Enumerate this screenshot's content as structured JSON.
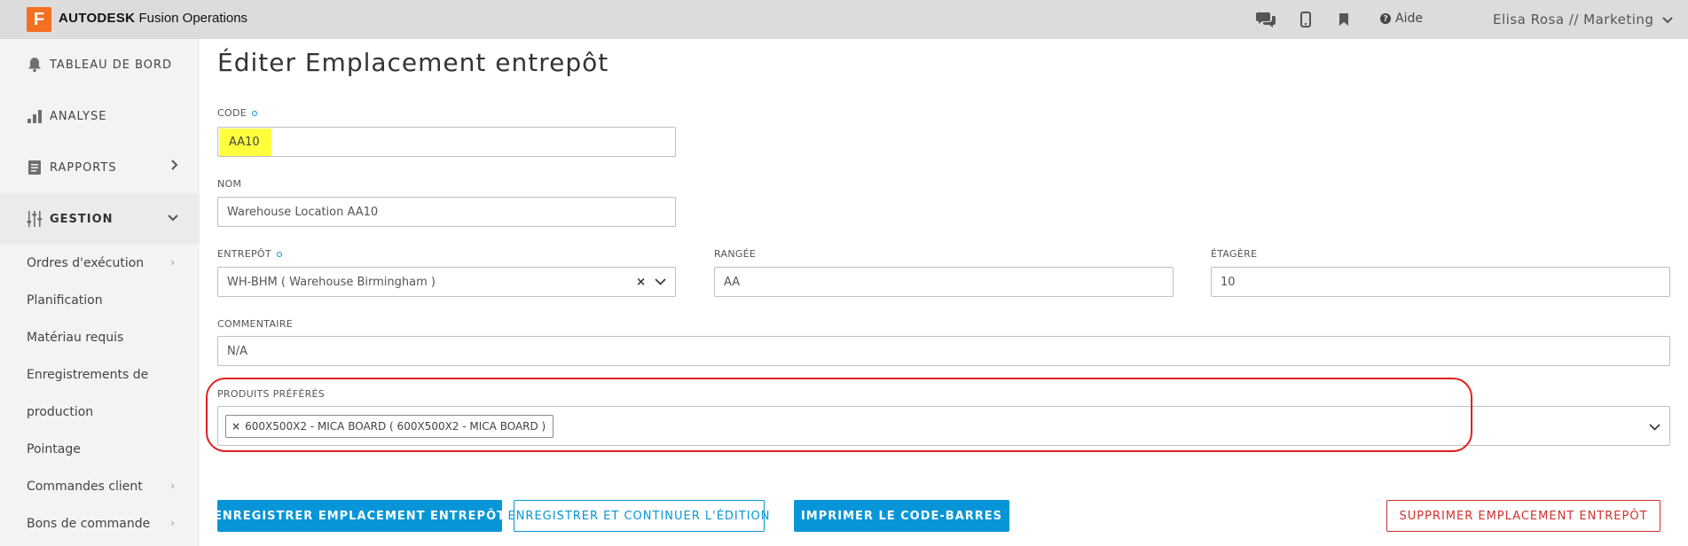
{
  "app": {
    "logo_letter": "F",
    "brand_bold": "AUTODESK",
    "brand_rest": "Fusion Operations",
    "help_label": "Aide",
    "user_label": "Elisa Rosa // Marketing"
  },
  "sidebar": {
    "top_items": [
      {
        "label": "TABLEAU DE BORD",
        "icon": "bell-icon"
      },
      {
        "label": "ANALYSE",
        "icon": "bar-chart-icon"
      },
      {
        "label": "RAPPORTS",
        "icon": "report-icon"
      },
      {
        "label": "GESTION",
        "icon": "sliders-icon"
      }
    ],
    "sub_items": [
      {
        "label": "Ordres d'exécution"
      },
      {
        "label": "Planification"
      },
      {
        "label": "Matériau requis"
      },
      {
        "label": "Enregistrements de"
      },
      {
        "label": "production"
      },
      {
        "label": "Pointage"
      },
      {
        "label": "Commandes client"
      },
      {
        "label": "Bons de commande"
      }
    ]
  },
  "page": {
    "title": "Éditer Emplacement entrepôt"
  },
  "form": {
    "code_label": "CODE",
    "code_value": "AA10",
    "name_label": "NOM",
    "name_value": "Warehouse Location AA10",
    "warehouse_label": "ENTREPÔT",
    "warehouse_value": "WH-BHM ( Warehouse Birmingham )",
    "row_label": "RANGÉE",
    "row_value": "AA",
    "shelf_label": "ÉTAGÈRE",
    "shelf_value": "10",
    "comment_label": "COMMENTAIRE",
    "comment_value": "N/A",
    "products_label": "PRODUITS PRÉFÉRÉS",
    "products_tag": "600X500X2 - MICA BOARD ( 600X500X2 - MICA BOARD )"
  },
  "buttons": {
    "save": "ENREGISTRER EMPLACEMENT ENTREPÔT",
    "save_continue": "ENREGISTRER ET CONTINUER L'ÉDITION",
    "print_barcode": "IMPRIMER LE CODE-BARRES",
    "delete": "SUPPRIMER EMPLACEMENT ENTREPÔT"
  },
  "colors": {
    "accent": "#0696d7",
    "brand": "#f37021",
    "danger": "#d0312d",
    "highlight": "#ffff3d",
    "annotation": "#e02020"
  }
}
